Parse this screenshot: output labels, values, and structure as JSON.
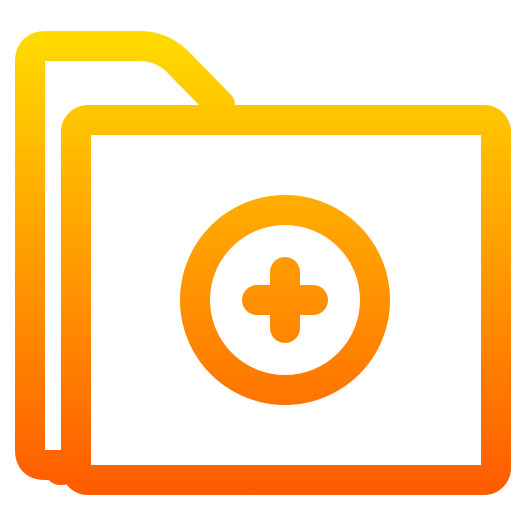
{
  "icon": {
    "name": "add-folder-icon",
    "gradient": {
      "top": "#FFE000",
      "bottom": "#FF5A00"
    },
    "background": "#FFFFFF"
  }
}
